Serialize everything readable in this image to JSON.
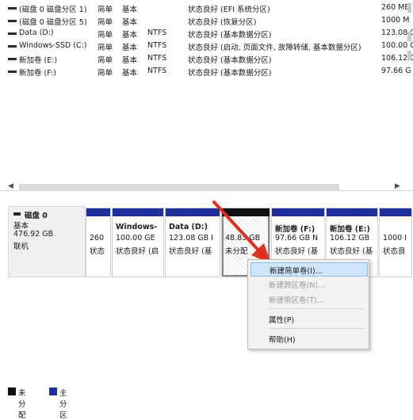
{
  "volumes": [
    {
      "name": "(磁盘 0 磁盘分区 1)",
      "layout": "简单",
      "type": "基本",
      "fs": "",
      "status": "状态良好 (EFI 系统分区)",
      "capacity": "260 MB"
    },
    {
      "name": "(磁盘 0 磁盘分区 5)",
      "layout": "简单",
      "type": "基本",
      "fs": "",
      "status": "状态良好 (恢复分区)",
      "capacity": "1000 M"
    },
    {
      "name": "Data (D:)",
      "layout": "简单",
      "type": "基本",
      "fs": "NTFS",
      "status": "状态良好 (基本数据分区)",
      "capacity": "123.08 G"
    },
    {
      "name": "Windows-SSD (C:)",
      "layout": "简单",
      "type": "基本",
      "fs": "NTFS",
      "status": "状态良好 (启动, 页面文件, 故障转储, 基本数据分区)",
      "capacity": "100.00 G"
    },
    {
      "name": "新加卷 (E:)",
      "layout": "简单",
      "type": "基本",
      "fs": "NTFS",
      "status": "状态良好 (基本数据分区)",
      "capacity": "106.12 G"
    },
    {
      "name": "新加卷 (F:)",
      "layout": "简单",
      "type": "基本",
      "fs": "NTFS",
      "status": "状态良好 (基本数据分区)",
      "capacity": "97.66 G"
    }
  ],
  "disk": {
    "title": "磁盘 0",
    "type": "基本",
    "size": "476.92 GB",
    "state": "联机"
  },
  "partitions": [
    {
      "name": "",
      "size": "260",
      "status": "状态",
      "kind": "primary"
    },
    {
      "name": "Windows-",
      "size": "100.00 GE",
      "status": "状态良好 (启",
      "kind": "primary"
    },
    {
      "name": "Data  (D:)",
      "size": "123.08 GB I",
      "status": "状态良好 (基",
      "kind": "primary"
    },
    {
      "name": "",
      "size": "48.83 GB",
      "status": "未分配",
      "kind": "unallocated"
    },
    {
      "name": "新加卷  (F:)",
      "size": "97.66 GB N",
      "status": "状态良好 (基",
      "kind": "primary"
    },
    {
      "name": "新加卷  (E:)",
      "size": "106.12 GB",
      "status": "状态良好 (基",
      "kind": "primary"
    },
    {
      "name": "",
      "size": "1000 I",
      "status": "状态良",
      "kind": "primary"
    }
  ],
  "context_menu": {
    "new_simple": "新建简单卷(I)...",
    "new_spanned": "新建跨区卷(N)...",
    "new_striped": "新建带区卷(T)...",
    "properties": "属性(P)",
    "help": "帮助(H)"
  },
  "legend": {
    "unallocated": "未分配",
    "primary": "主分区",
    "unallocated_color": "#111111",
    "primary_color": "#1f2f9c"
  },
  "colors": {
    "partition_header": "#1f2f9c",
    "menu_highlight": "#cfe6fa",
    "arrow": "#e0301e"
  }
}
